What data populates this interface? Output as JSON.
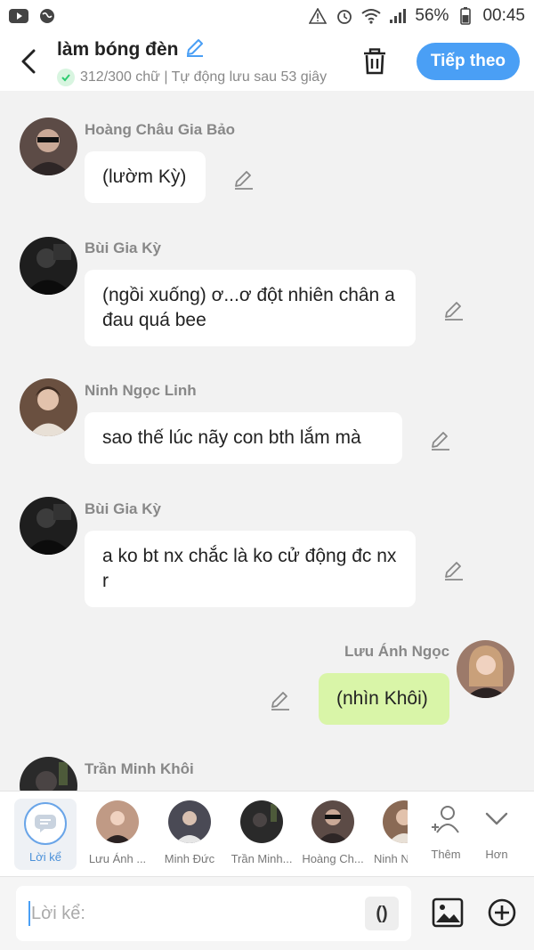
{
  "status_bar": {
    "battery": "56%",
    "time": "00:45"
  },
  "header": {
    "title": "làm bóng đèn",
    "counter": "312/300 chữ | Tự động lưu sau 53 giây",
    "next_label": "Tiếp theo"
  },
  "messages": [
    {
      "name": "Hoàng Châu Gia Bảo",
      "text": "(lườm Kỳ)",
      "self": false,
      "avatar_color": "#3a3030"
    },
    {
      "name": "Bùi Gia Kỳ",
      "text": "(ngồi xuống) ơ...ơ đột nhiên chân a đau quá bee",
      "self": false,
      "avatar_color": "#1e1e1e"
    },
    {
      "name": "Ninh Ngọc Linh",
      "text": "sao thế lúc nãy con bth lắm mà",
      "self": false,
      "avatar_color": "#8a6a55"
    },
    {
      "name": "Bùi Gia Kỳ",
      "text": "a ko bt nx chắc là ko cử động đc nx r",
      "self": false,
      "avatar_color": "#1e1e1e"
    },
    {
      "name": "Lưu Ánh Ngọc",
      "text": "(nhìn Khôi)",
      "self": true,
      "avatar_color": "#b08a78"
    },
    {
      "name": "Trần Minh Khôi",
      "text": "",
      "self": false,
      "avatar_color": "#2a2a2a"
    }
  ],
  "characters": [
    {
      "label": "Lời kể",
      "selected": true
    },
    {
      "label": "Lưu Ánh ...",
      "avatar_color": "#c09a85"
    },
    {
      "label": "Minh Đức",
      "avatar_color": "#4a4a55"
    },
    {
      "label": "Trần Minh...",
      "avatar_color": "#2a2a2a"
    },
    {
      "label": "Hoàng Ch...",
      "avatar_color": "#3a3030"
    },
    {
      "label": "Ninh N",
      "avatar_color": "#8a6a55"
    }
  ],
  "tools": {
    "more_label": "Thêm",
    "expand_label": "Hơn"
  },
  "input": {
    "placeholder": "Lời kể:",
    "paren": "()"
  },
  "colors": {
    "accent": "#4a9ff5",
    "self_bubble": "#d9f5a8",
    "check": "#2ecc71"
  }
}
